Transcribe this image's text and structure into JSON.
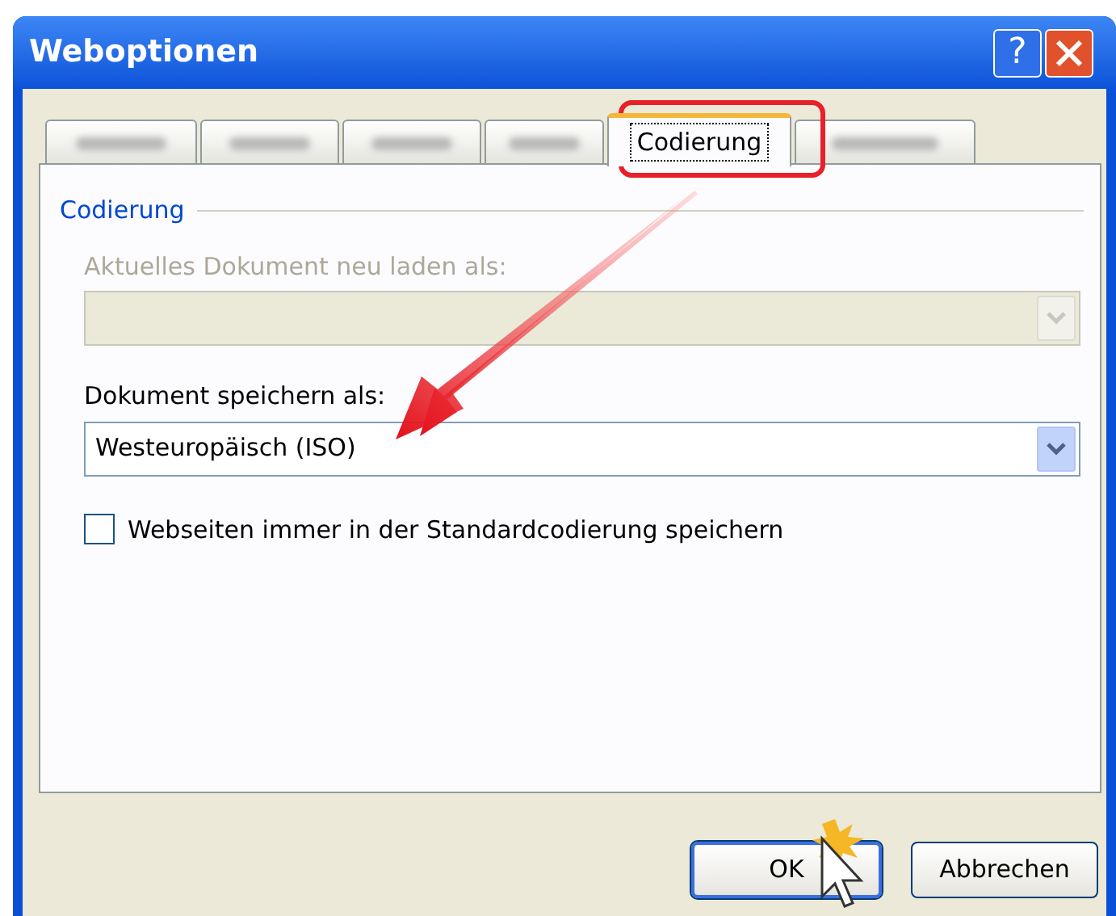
{
  "window": {
    "title": "Weboptionen",
    "help_button": "?"
  },
  "tabs": [
    {
      "blurred": true,
      "selected": false
    },
    {
      "blurred": true,
      "selected": false
    },
    {
      "blurred": true,
      "selected": false
    },
    {
      "blurred": true,
      "selected": false
    },
    {
      "label": "Codierung",
      "blurred": false,
      "selected": true
    },
    {
      "blurred": true,
      "selected": false
    }
  ],
  "group": {
    "title": "Codierung"
  },
  "fields": [
    {
      "label": "Aktuelles Dokument neu laden als:",
      "disabled": true
    },
    {
      "label": "Dokument speichern als:",
      "value": "Westeuropäisch (ISO)",
      "disabled": false
    }
  ],
  "checkbox": {
    "label": "Webseiten immer in der Standardcodierung speichern",
    "checked": false
  },
  "buttons": [
    {
      "label": "OK",
      "default": true
    },
    {
      "label": "Abbrechen",
      "default": false
    }
  ]
}
